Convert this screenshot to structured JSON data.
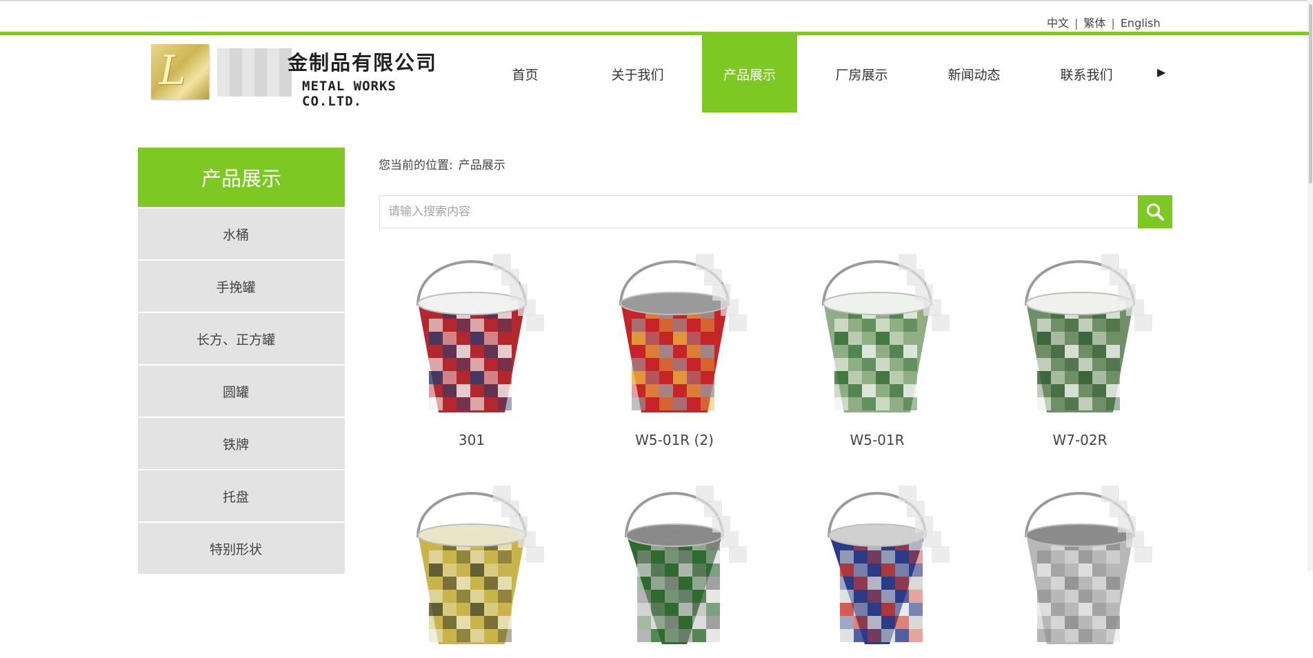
{
  "languages": [
    {
      "label": "中文",
      "active": true
    },
    {
      "label": "繁体",
      "active": false
    },
    {
      "label": "English",
      "active": false
    }
  ],
  "brand": {
    "name_cn": "金制品有限公司",
    "name_en": "METAL WORKS CO.LTD.",
    "emblem_letter": "L",
    "emblem_color": "#cdb454"
  },
  "nav": {
    "items": [
      {
        "label": "首页",
        "active": false
      },
      {
        "label": "关于我们",
        "active": false
      },
      {
        "label": "产品展示",
        "active": true
      },
      {
        "label": "厂房展示",
        "active": false
      },
      {
        "label": "新闻动态",
        "active": false
      },
      {
        "label": "联系我们",
        "active": false
      }
    ],
    "more_icon": "triangle-right-icon"
  },
  "sidebar": {
    "title": "产品展示",
    "items": [
      "水桶",
      "手挽罐",
      "长方、正方罐",
      "圆罐",
      "铁牌",
      "托盘",
      "特别形状"
    ]
  },
  "breadcrumb": {
    "label": "您当前的位置:",
    "current": "产品展示"
  },
  "search": {
    "placeholder": "请输入搜索内容",
    "value": "",
    "icon": "magnifier-icon"
  },
  "products": [
    {
      "name": "301",
      "type": "pail",
      "colors": [
        "#b3282d",
        "#2f3b6e",
        "#f1f1f1"
      ]
    },
    {
      "name": "W5-01R (2)",
      "type": "pail",
      "colors": [
        "#c7242a",
        "#e8b23a",
        "#9a9a9a"
      ]
    },
    {
      "name": "W5-01R",
      "type": "pail",
      "colors": [
        "#8fae84",
        "#2f6d34",
        "#eef2ec"
      ]
    },
    {
      "name": "W7-02R",
      "type": "pail",
      "colors": [
        "#6f8f66",
        "#305e34",
        "#eef1ec"
      ]
    },
    {
      "name": "",
      "type": "pail",
      "colors": [
        "#c9b44a",
        "#4b4b2e",
        "#e9e6c8"
      ]
    },
    {
      "name": "",
      "type": "tub",
      "colors": [
        "#2e6b2f",
        "#c9c9c9",
        "#8a8a8a"
      ]
    },
    {
      "name": "",
      "type": "tub",
      "colors": [
        "#2a3c88",
        "#c9382b",
        "#d0d0d0"
      ]
    },
    {
      "name": "",
      "type": "pail",
      "colors": [
        "#b8b8b8",
        "#e6e6e6",
        "#8c8c8c"
      ]
    }
  ],
  "colors": {
    "accent": "#7dc823",
    "sidebar_item_bg": "#e3e3e3",
    "active_language": "#7dc823"
  }
}
